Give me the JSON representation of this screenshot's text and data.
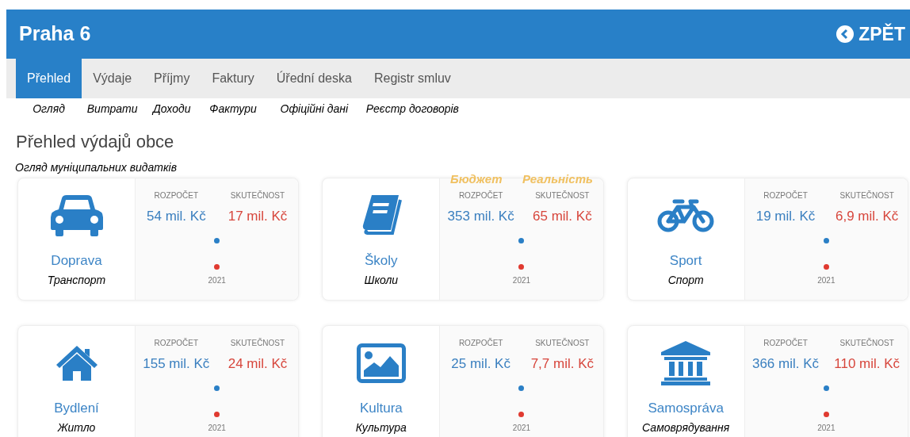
{
  "header": {
    "title": "Praha 6",
    "back_label": "ZPĚT"
  },
  "tabs": [
    {
      "label": "Přehled",
      "translation": "Огляд",
      "selected": true
    },
    {
      "label": "Výdaje",
      "translation": "Витрати",
      "selected": false
    },
    {
      "label": "Příjmy",
      "translation": "Доходи",
      "selected": false
    },
    {
      "label": "Faktury",
      "translation": "Фактури",
      "selected": false
    },
    {
      "label": "Úřední deska",
      "translation": "Офіційні дані",
      "selected": false
    },
    {
      "label": "Registr smluv",
      "translation": "Реєстр договорів",
      "selected": false
    }
  ],
  "heading": "Přehled výdajů obce",
  "heading_translation": "Огляд муніципальних видатків",
  "cards": [
    {
      "name": "Doprava",
      "translation": "Транспорт",
      "budget_label": "ROZPOČET",
      "actual_label": "SKUTEČNOST",
      "budget": "54 mil. Kč",
      "actual": "17 mil. Kč",
      "year": "2021"
    },
    {
      "name": "Školy",
      "translation": "Школи",
      "budget_label": "ROZPOČET",
      "actual_label": "SKUTEČNOST",
      "budget": "353 mil. Kč",
      "actual": "65 mil. Kč",
      "year": "2021",
      "budget_note": "Бюджет",
      "actual_note": "Реальність"
    },
    {
      "name": "Sport",
      "translation": "Спорт",
      "budget_label": "ROZPOČET",
      "actual_label": "SKUTEČNOST",
      "budget": "19 mil. Kč",
      "actual": "6,9 mil. Kč",
      "year": "2021"
    },
    {
      "name": "Bydlení",
      "translation": "Житло",
      "budget_label": "ROZPOČET",
      "actual_label": "SKUTEČNOST",
      "budget": "155 mil. Kč",
      "actual": "24 mil. Kč",
      "year": "2021"
    },
    {
      "name": "Kultura",
      "translation": "Культура",
      "budget_label": "ROZPOČET",
      "actual_label": "SKUTEČNOST",
      "budget": "25 mil. Kč",
      "actual": "7,7 mil. Kč",
      "year": "2021"
    },
    {
      "name": "Samospráva",
      "translation": "Самоврядування",
      "budget_label": "ROZPOČET",
      "actual_label": "SKUTEČNOST",
      "budget": "366 mil. Kč",
      "actual": "110 mil. Kč",
      "year": "2021"
    }
  ]
}
